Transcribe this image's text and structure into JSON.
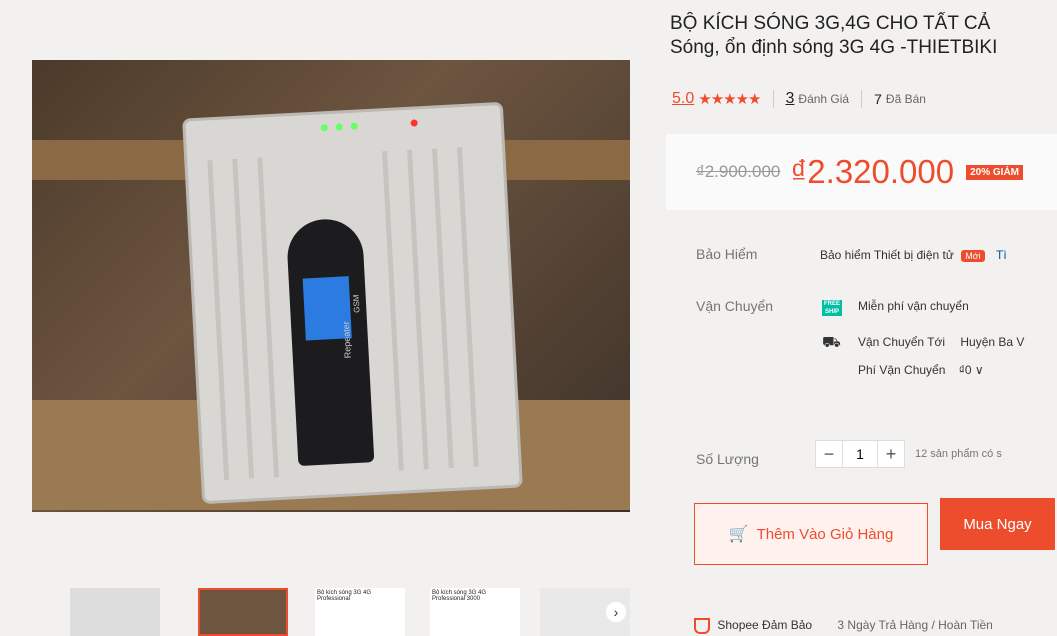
{
  "product": {
    "title_line1": "BỘ KÍCH SÓNG 3G,4G CHO TẤT CẢ",
    "title_line2": "Sóng, ổn định sóng 3G 4G -THIETBIKI",
    "rating_score": "5.0",
    "stars": "★★★★★",
    "reviews_count": "3",
    "reviews_label": "Đánh Giá",
    "sold_count": "7",
    "sold_label": "Đã Bán",
    "old_price": "₫2.900.000",
    "new_price": "₫2.320.000",
    "discount_badge": "20% GIẢM",
    "device_labels": {
      "repeater": "Repeater",
      "gsm": "GSM"
    }
  },
  "insurance": {
    "label": "Bảo Hiểm",
    "value": "Bảo hiểm Thiết bị điện tử",
    "badge": "Mới",
    "link": "Tì"
  },
  "shipping": {
    "label": "Vận Chuyển",
    "free_icon_text": "FREE SHIP",
    "free_text": "Miễn phí vận chuyển",
    "to_label": "Vận Chuyển Tới",
    "to_value": "Huyện Ba V",
    "fee_label": "Phí Vận Chuyển",
    "fee_value": "₫0 ∨"
  },
  "quantity": {
    "label": "Số Lượng",
    "minus": "−",
    "value": "1",
    "plus": "+",
    "stock": "12 sản phẩm có s"
  },
  "actions": {
    "add_to_cart": "Thêm Vào Giỏ Hàng",
    "buy_now": "Mua Ngay"
  },
  "guarantee": {
    "label": "Shopee Đảm Bảo",
    "text": "3 Ngày Trả Hàng / Hoàn Tiền"
  },
  "thumbnails": {
    "next_label": "›",
    "captions": [
      "Bộ kích sóng 3G 4G Professional",
      "Bộ kích sóng 3G 4G Professional 3000"
    ]
  }
}
